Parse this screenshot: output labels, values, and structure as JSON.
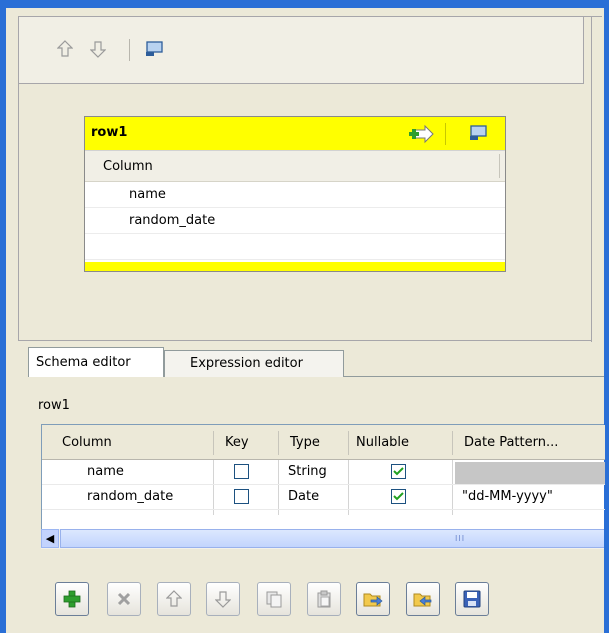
{
  "mapper": {
    "table_name": "row1",
    "column_header": "Column",
    "columns": [
      "name",
      "random_date"
    ]
  },
  "tabs": [
    {
      "label": "Schema editor",
      "active": true
    },
    {
      "label": "Expression editor",
      "active": false
    }
  ],
  "schema": {
    "title": "row1",
    "headers": [
      "Column",
      "Key",
      "Type",
      "Nullable",
      "Date Pattern..."
    ],
    "rows": [
      {
        "column": "name",
        "key": false,
        "type": "String",
        "nullable": true,
        "date_pattern": ""
      },
      {
        "column": "random_date",
        "key": false,
        "type": "Date",
        "nullable": true,
        "date_pattern": "\"dd-MM-yyyy\""
      }
    ],
    "scroll_grip": "III"
  },
  "colors": {
    "title_bar": "#2a6fd6",
    "table_header": "#ffff00",
    "add_icon": "#2e9e2e",
    "up_down_arrow": "#9a9a9a"
  }
}
